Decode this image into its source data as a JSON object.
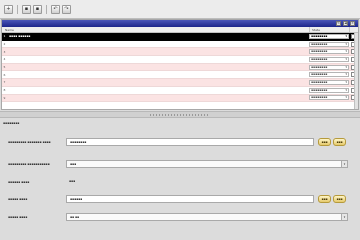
{
  "toolbar": {
    "buttons": [
      {
        "icon": "new-icon",
        "glyph": "+"
      },
      {
        "icon": "save-icon",
        "glyph": "▪"
      },
      {
        "icon": "save-all-icon",
        "glyph": "▪"
      },
      {
        "icon": "undo-icon",
        "glyph": "↶"
      },
      {
        "icon": "redo-icon",
        "glyph": "↷"
      }
    ]
  },
  "panel": {
    "title": "",
    "tool_glyphs": [
      "↻",
      "◀",
      "✕"
    ],
    "columns": {
      "name": "Name",
      "state": "State"
    }
  },
  "grid": {
    "rows": [
      {
        "num": "1",
        "name": "▪▪▪▪ ▪▪▪▪▪▪",
        "state": "▪▪▪▪▪▪▪▪",
        "selected": true
      },
      {
        "num": "2",
        "name": "",
        "state": "▪▪▪▪▪▪▪▪",
        "selected": false
      },
      {
        "num": "3",
        "name": "",
        "state": "▪▪▪▪▪▪▪▪",
        "selected": false
      },
      {
        "num": "4",
        "name": "",
        "state": "▪▪▪▪▪▪▪▪",
        "selected": false
      },
      {
        "num": "5",
        "name": "",
        "state": "▪▪▪▪▪▪▪▪",
        "selected": false
      },
      {
        "num": "6",
        "name": "",
        "state": "▪▪▪▪▪▪▪▪",
        "selected": false
      },
      {
        "num": "7",
        "name": "",
        "state": "▪▪▪▪▪▪▪▪",
        "selected": false
      },
      {
        "num": "8",
        "name": "",
        "state": "▪▪▪▪▪▪▪▪",
        "selected": false
      },
      {
        "num": "9",
        "name": "",
        "state": "▪▪▪▪▪▪▪▪",
        "selected": false
      }
    ]
  },
  "props": {
    "caption": "▪▪▪▪▪▪▪▪",
    "fields": [
      {
        "label": "▪▪▪▪▪▪▪▪▪ ▪▪▪▪▪▪▪ ▪▪▪▪",
        "value": "▪▪▪▪▪▪▪▪",
        "kind": "text",
        "buttons": [
          "▪▪▪",
          "▪▪▪"
        ]
      },
      {
        "label": "▪▪▪▪▪▪▪▪▪ ▪▪▪▪▪▪▪▪▪▪▪",
        "value": "▪▪▪",
        "kind": "combo",
        "buttons": []
      },
      {
        "label": "▪▪▪▪▪▪ ▪▪▪▪",
        "value": "▪▪▪",
        "kind": "plain",
        "buttons": []
      },
      {
        "label": "▪▪▪▪▪ ▪▪▪▪",
        "value": "▪▪▪▪▪▪",
        "kind": "text",
        "buttons": [
          "▪▪▪",
          "▪▪▪"
        ]
      },
      {
        "label": "▪▪▪▪▪ ▪▪▪▪",
        "value": "▪▪ ▪▪",
        "kind": "combo",
        "buttons": []
      }
    ]
  }
}
